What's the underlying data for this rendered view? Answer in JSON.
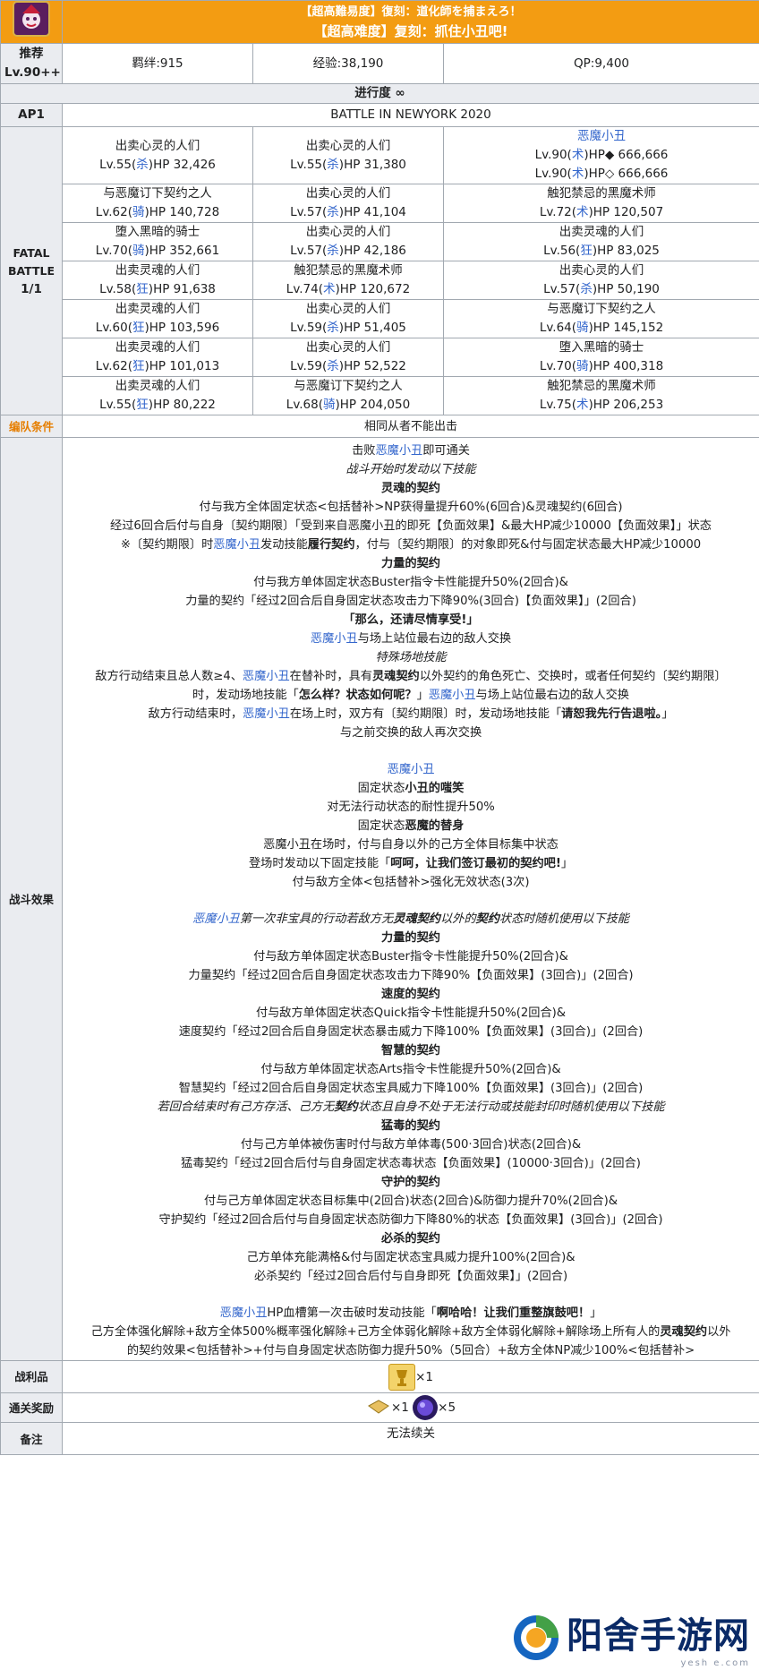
{
  "header": {
    "title_jp": "【超高難易度】復刻：道化師を捕まえろ！",
    "title_cn": "【超高难度】复刻：抓住小丑吧!",
    "rec_label": "推荐",
    "rec_level": "Lv.90++",
    "bond": "羁绊:915",
    "exp": "经验:38,190",
    "qp": "QP:9,400",
    "progress": "进行度 ∞",
    "ap_label": "AP1",
    "battle_name": "BATTLE IN NEWYORK 2020",
    "fatal_label_1": "FATAL",
    "fatal_label_2": "BATTLE",
    "fatal_label_3": "1/1"
  },
  "enemies": [
    [
      {
        "name": "出卖心灵的人们",
        "lv": "Lv.55(",
        "cls": "杀",
        "hp": ")HP 32,426"
      },
      {
        "name": "出卖心灵的人们",
        "lv": "Lv.55(",
        "cls": "杀",
        "hp": ")HP 31,380"
      },
      {
        "name": "恶魔小丑",
        "link": true,
        "lv": "Lv.90(",
        "cls": "术",
        "hp": ")HP◆ 666,666",
        "lv2": "Lv.90(",
        "cls2": "术",
        "hp2": ")HP◇ 666,666"
      }
    ],
    [
      {
        "name": "与恶魔订下契约之人",
        "lv": "Lv.62(",
        "cls": "骑",
        "hp": ")HP 140,728"
      },
      {
        "name": "出卖心灵的人们",
        "lv": "Lv.57(",
        "cls": "杀",
        "hp": ")HP 41,104"
      },
      {
        "name": "触犯禁忌的黑魔术师",
        "lv": "Lv.72(",
        "cls": "术",
        "hp": ")HP 120,507"
      }
    ],
    [
      {
        "name": "堕入黑暗的骑士",
        "lv": "Lv.70(",
        "cls": "骑",
        "hp": ")HP 352,661"
      },
      {
        "name": "出卖心灵的人们",
        "lv": "Lv.57(",
        "cls": "杀",
        "hp": ")HP 42,186"
      },
      {
        "name": "出卖灵魂的人们",
        "lv": "Lv.56(",
        "cls": "狂",
        "hp": ")HP 83,025"
      }
    ],
    [
      {
        "name": "出卖灵魂的人们",
        "lv": "Lv.58(",
        "cls": "狂",
        "hp": ")HP 91,638"
      },
      {
        "name": "触犯禁忌的黑魔术师",
        "lv": "Lv.74(",
        "cls": "术",
        "hp": ")HP 120,672"
      },
      {
        "name": "出卖心灵的人们",
        "lv": "Lv.57(",
        "cls": "杀",
        "hp": ")HP 50,190"
      }
    ],
    [
      {
        "name": "出卖灵魂的人们",
        "lv": "Lv.60(",
        "cls": "狂",
        "hp": ")HP 103,596"
      },
      {
        "name": "出卖心灵的人们",
        "lv": "Lv.59(",
        "cls": "杀",
        "hp": ")HP 51,405"
      },
      {
        "name": "与恶魔订下契约之人",
        "lv": "Lv.64(",
        "cls": "骑",
        "hp": ")HP 145,152"
      }
    ],
    [
      {
        "name": "出卖灵魂的人们",
        "lv": "Lv.62(",
        "cls": "狂",
        "hp": ")HP 101,013"
      },
      {
        "name": "出卖心灵的人们",
        "lv": "Lv.59(",
        "cls": "杀",
        "hp": ")HP 52,522"
      },
      {
        "name": "堕入黑暗的骑士",
        "lv": "Lv.70(",
        "cls": "骑",
        "hp": ")HP 400,318"
      }
    ],
    [
      {
        "name": "出卖灵魂的人们",
        "lv": "Lv.55(",
        "cls": "狂",
        "hp": ")HP 80,222"
      },
      {
        "name": "与恶魔订下契约之人",
        "lv": "Lv.68(",
        "cls": "骑",
        "hp": ")HP 204,050"
      },
      {
        "name": "触犯禁忌的黑魔术师",
        "lv": "Lv.75(",
        "cls": "术",
        "hp": ")HP 206,253"
      }
    ]
  ],
  "formation": {
    "label": "编队条件",
    "value": "相同从者不能出击"
  },
  "effects": {
    "label": "战斗效果",
    "lines": [
      [
        {
          "t": "击败"
        },
        {
          "t": "恶魔小丑",
          "c": "lnk"
        },
        {
          "t": "即可通关"
        }
      ],
      [
        {
          "t": "战斗开始时发动以下技能",
          "c": "ital"
        }
      ],
      [
        {
          "t": "灵魂的契约",
          "c": "bold"
        }
      ],
      [
        {
          "t": "付与我方全体固定状态<包括替补>NP获得量提升60%(6回合)&灵魂契约(6回合)"
        }
      ],
      [
        {
          "t": "经过6回合后付与自身〔契约期限〕「受到来自恶魔小丑的即死【负面效果】&最大HP减少10000【负面效果】」状态"
        }
      ],
      [
        {
          "t": "※〔契约期限〕时"
        },
        {
          "t": "恶魔小丑",
          "c": "lnk"
        },
        {
          "t": "发动技能"
        },
        {
          "t": "履行契约",
          "c": "bold"
        },
        {
          "t": "，付与〔契约期限〕的对象即死&付与固定状态最大HP减少10000"
        }
      ],
      [
        {
          "t": "力量的契约",
          "c": "bold"
        }
      ],
      [
        {
          "t": "付与我方单体固定状态Buster指令卡性能提升50%(2回合)&"
        }
      ],
      [
        {
          "t": "力量的契约「经过2回合后自身固定状态攻击力下降90%(3回合)【负面效果】」(2回合)"
        }
      ],
      [
        {
          "t": "「那么，还请尽情享受!」",
          "c": "bold"
        }
      ],
      [
        {
          "t": "恶魔小丑",
          "c": "lnk"
        },
        {
          "t": "与场上站位最右边的敌人交换"
        }
      ],
      [
        {
          "t": "特殊场地技能",
          "c": "ital"
        }
      ],
      [
        {
          "t": "敌方行动结束且总人数≥4、"
        },
        {
          "t": "恶魔小丑",
          "c": "lnk"
        },
        {
          "t": "在替补时，具有"
        },
        {
          "t": "灵魂契约",
          "c": "bold"
        },
        {
          "t": "以外契约的角色死亡、交换时，或者任何契约〔契约期限〕"
        }
      ],
      [
        {
          "t": "时，发动场地技能「"
        },
        {
          "t": "怎么样？状态如何呢？",
          "c": "bold"
        },
        {
          "t": "」"
        },
        {
          "t": "恶魔小丑",
          "c": "lnk"
        },
        {
          "t": "与场上站位最右边的敌人交换"
        }
      ],
      [
        {
          "t": "敌方行动结束时，"
        },
        {
          "t": "恶魔小丑",
          "c": "lnk"
        },
        {
          "t": "在场上时，双方有〔契约期限〕时，发动场地技能「"
        },
        {
          "t": "请恕我先行告退啦。",
          "c": "bold"
        },
        {
          "t": "」"
        }
      ],
      [
        {
          "t": "与之前交换的敌人再次交换"
        }
      ],
      "GAP",
      [
        {
          "t": "恶魔小丑",
          "c": "lnk"
        }
      ],
      [
        {
          "t": "固定状态"
        },
        {
          "t": "小丑的嗤笑",
          "c": "bold"
        }
      ],
      [
        {
          "t": "对无法行动状态的耐性提升50%"
        }
      ],
      [
        {
          "t": "固定状态"
        },
        {
          "t": "恶魔的替身",
          "c": "bold"
        }
      ],
      [
        {
          "t": "恶魔小丑在场时，付与自身以外的己方全体目标集中状态"
        }
      ],
      [
        {
          "t": "登场时发动以下固定技能「"
        },
        {
          "t": "呵呵，让我们签订最初的契约吧!",
          "c": "bold"
        },
        {
          "t": "」"
        }
      ],
      [
        {
          "t": "付与敌方全体<包括替补>强化无效状态(3次)"
        }
      ],
      "GAP",
      [
        {
          "t": "恶魔小丑",
          "c": "lnk ital"
        },
        {
          "t": "第一次非宝具的行动若敌方无",
          "c": "ital"
        },
        {
          "t": "灵魂契约",
          "c": "bold ital"
        },
        {
          "t": "以外的",
          "c": "ital"
        },
        {
          "t": "契约",
          "c": "bold ital"
        },
        {
          "t": "状态时随机使用以下技能",
          "c": "ital"
        }
      ],
      [
        {
          "t": "力量的契约",
          "c": "bold"
        }
      ],
      [
        {
          "t": "付与敌方单体固定状态Buster指令卡性能提升50%(2回合)&"
        }
      ],
      [
        {
          "t": "力量契约「经过2回合后自身固定状态攻击力下降90%【负面效果】(3回合)」(2回合)"
        }
      ],
      [
        {
          "t": "速度的契约",
          "c": "bold"
        }
      ],
      [
        {
          "t": "付与敌方单体固定状态Quick指令卡性能提升50%(2回合)&"
        }
      ],
      [
        {
          "t": "速度契约「经过2回合后自身固定状态暴击威力下降100%【负面效果】(3回合)」(2回合)"
        }
      ],
      [
        {
          "t": "智慧的契约",
          "c": "bold"
        }
      ],
      [
        {
          "t": "付与敌方单体固定状态Arts指令卡性能提升50%(2回合)&"
        }
      ],
      [
        {
          "t": "智慧契约「经过2回合后自身固定状态宝具威力下降100%【负面效果】(3回合)」(2回合)"
        }
      ],
      [
        {
          "t": "若回合结束时有己方存活、己方无",
          "c": "ital"
        },
        {
          "t": "契约",
          "c": "bold ital"
        },
        {
          "t": "状态且自身不处于无法行动或技能封印时随机使用以下技能",
          "c": "ital"
        }
      ],
      [
        {
          "t": "猛毒的契约",
          "c": "bold"
        }
      ],
      [
        {
          "t": "付与己方单体被伤害时付与敌方单体毒(500·3回合)状态(2回合)&"
        }
      ],
      [
        {
          "t": "猛毒契约「经过2回合后付与自身固定状态毒状态【负面效果】(10000·3回合)」(2回合)"
        }
      ],
      [
        {
          "t": "守护的契约",
          "c": "bold"
        }
      ],
      [
        {
          "t": "付与己方单体固定状态目标集中(2回合)状态(2回合)&防御力提升70%(2回合)&"
        }
      ],
      [
        {
          "t": "守护契约「经过2回合后付与自身固定状态防御力下降80%的状态【负面效果】(3回合)」(2回合)"
        }
      ],
      [
        {
          "t": "必杀的契约",
          "c": "bold"
        }
      ],
      [
        {
          "t": "己方单体充能满格&付与固定状态宝具威力提升100%(2回合)&"
        }
      ],
      [
        {
          "t": "必杀契约「经过2回合后付与自身即死【负面效果】」(2回合)"
        }
      ],
      "GAP",
      [
        {
          "t": "恶魔小丑",
          "c": "lnk"
        },
        {
          "t": "HP血槽第一次击破时发动技能「"
        },
        {
          "t": "啊哈哈！让我们重整旗鼓吧！",
          "c": "bold"
        },
        {
          "t": "」"
        }
      ],
      [
        {
          "t": "己方全体强化解除+敌方全体500%概率强化解除+己方全体弱化解除+敌方全体弱化解除+解除场上所有人的"
        },
        {
          "t": "灵魂契约",
          "c": "bold"
        },
        {
          "t": "以外"
        }
      ],
      [
        {
          "t": "的契约效果<包括替补>+付与自身固定状态防御力提升50%（5回合）+敌方全体NP减少100%<包括替补>"
        }
      ]
    ]
  },
  "loot": {
    "label": "战利品",
    "count": "×1",
    "icon": "gold-grail-item-icon"
  },
  "clear_reward": {
    "label": "通关奖励",
    "count1": "×1",
    "count2": "×5",
    "icon1": "golden-ticket-icon",
    "icon2": "purple-gem-icon"
  },
  "remarks": {
    "label": "备注",
    "value": "无法续关"
  },
  "watermark": {
    "text": "阳舍手游网",
    "sub": "yesh e.com"
  },
  "colors": {
    "header_bg": "#eaecf0",
    "title_bg": "#f39c12",
    "link": "#3366cc",
    "accent_orange": "#e67e00"
  }
}
